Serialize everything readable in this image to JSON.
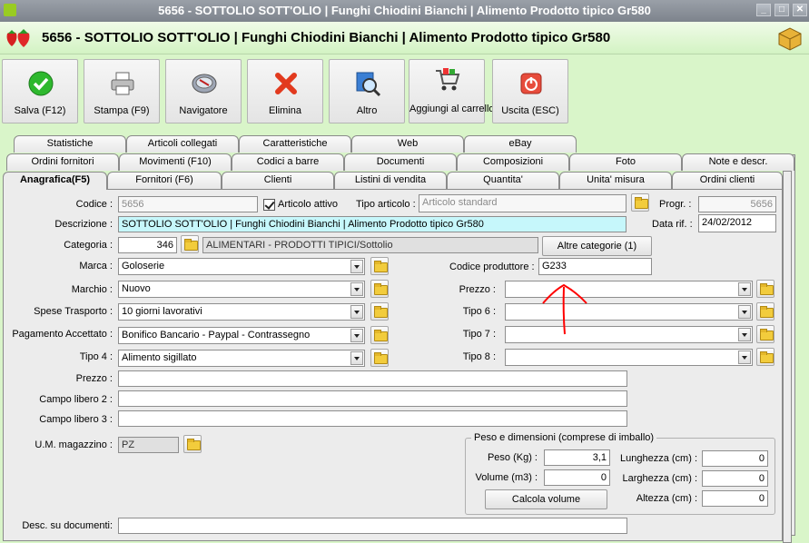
{
  "window": {
    "title": "5656 - SOTTOLIO SOTT'OLIO | Funghi Chiodini Bianchi | Alimento Prodotto tipico Gr580",
    "controls": {
      "minimize": "_",
      "maximize": "□",
      "close": "✕"
    }
  },
  "header": {
    "title": "5656 - SOTTOLIO SOTT'OLIO | Funghi Chiodini Bianchi | Alimento Prodotto tipico Gr580"
  },
  "toolbar": {
    "buttons": [
      {
        "label": "Salva (F12)",
        "icon": "check-icon"
      },
      {
        "label": "Stampa (F9)",
        "icon": "printer-icon"
      },
      {
        "label": "Navigatore",
        "icon": "compass-icon"
      },
      {
        "label": "Elimina",
        "icon": "delete-x-icon"
      },
      {
        "label": "Altro",
        "icon": "search-icon"
      },
      {
        "label": "Aggiungi al carrello",
        "icon": "cart-icon"
      },
      {
        "label": "Uscita (ESC)",
        "icon": "power-icon"
      }
    ]
  },
  "tabs": {
    "row1": [
      "Statistiche",
      "Articoli collegati",
      "Caratteristiche",
      "Web",
      "eBay"
    ],
    "row2": [
      "Ordini fornitori",
      "Movimenti (F10)",
      "Codici a barre",
      "Documenti",
      "Composizioni",
      "Foto",
      "Note e descr."
    ],
    "row3": [
      "Anagrafica(F5)",
      "Fornitori (F6)",
      "Clienti",
      "Listini di vendita",
      "Quantita'",
      "Unita' misura",
      "Ordini clienti"
    ]
  },
  "form": {
    "codice": {
      "label": "Codice :",
      "value": "5656"
    },
    "articolo_attivo": {
      "label": "Articolo attivo",
      "checked": true
    },
    "tipo_articolo": {
      "label": "Tipo articolo :",
      "value": "Articolo standard"
    },
    "progr": {
      "label": "Progr. :",
      "value": "5656"
    },
    "descrizione": {
      "label": "Descrizione :",
      "value": "SOTTOLIO SOTT'OLIO | Funghi Chiodini Bianchi | Alimento Prodotto tipico Gr580"
    },
    "data_rif": {
      "label": "Data rif. :",
      "value": "24/02/2012"
    },
    "categoria": {
      "label": "Categoria :",
      "code": "346",
      "name": "ALIMENTARI - PRODOTTI TIPICI/Sottolio"
    },
    "altre_categorie": {
      "label": "Altre categorie (1)"
    },
    "marca": {
      "label": "Marca :",
      "value": "Goloserie"
    },
    "codice_produttore": {
      "label": "Codice produttore :",
      "value": "G233"
    },
    "marchio": {
      "label": "Marchio :",
      "value": "Nuovo"
    },
    "prezzo_combo": {
      "label": "Prezzo :",
      "value": ""
    },
    "spese_trasporto": {
      "label": "Spese Trasporto :",
      "value": "10 giorni lavorativi"
    },
    "tipo6": {
      "label": "Tipo 6 :",
      "value": ""
    },
    "pagamento": {
      "label": "Pagamento Accettato :",
      "value": "Bonifico Bancario -  Paypal  - Contrassegno"
    },
    "tipo7": {
      "label": "Tipo 7 :",
      "value": ""
    },
    "tipo4": {
      "label": "Tipo 4 :",
      "value": "Alimento sigillato"
    },
    "tipo8": {
      "label": "Tipo 8 :",
      "value": ""
    },
    "prezzo_text": {
      "label": "Prezzo :",
      "value": ""
    },
    "campo_libero2": {
      "label": "Campo libero 2 :",
      "value": ""
    },
    "campo_libero3": {
      "label": "Campo libero 3 :",
      "value": ""
    },
    "um_magazzino": {
      "label": "U.M. magazzino :",
      "value": "PZ"
    },
    "desc_documenti": {
      "label": "Desc. su documenti:",
      "value": ""
    }
  },
  "peso_dimensioni": {
    "legend": "Peso e dimensioni (comprese di imballo)",
    "peso": {
      "label": "Peso (Kg) :",
      "value": "3,1"
    },
    "volume": {
      "label": "Volume (m3) :",
      "value": "0"
    },
    "lunghezza": {
      "label": "Lunghezza (cm) :",
      "value": "0"
    },
    "larghezza": {
      "label": "Larghezza (cm) :",
      "value": "0"
    },
    "altezza": {
      "label": "Altezza (cm) :",
      "value": "0"
    },
    "calcola": {
      "label": "Calcola volume"
    }
  },
  "colors": {
    "header_bg": "#d3f3c3",
    "highlight_field": "#c6f7fb",
    "annotation_arrow": "#ff0000"
  }
}
